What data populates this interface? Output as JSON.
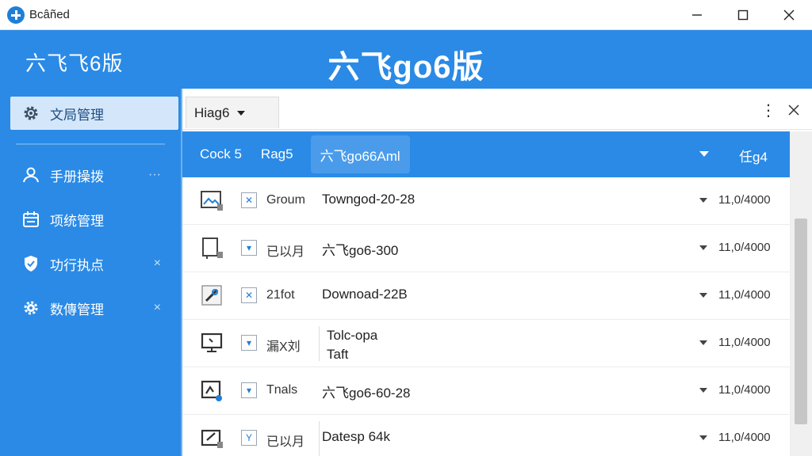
{
  "window": {
    "title": "Bcâñed",
    "controls": [
      "minimize-icon",
      "maximize-icon",
      "close-icon"
    ]
  },
  "header": {
    "brand": "六飞飞6版",
    "title": "六飞go6版"
  },
  "sidebar": {
    "items": [
      {
        "label": "文局管理",
        "icon": "gear-icon",
        "active": true,
        "tail": ""
      },
      {
        "label": "手册操拨",
        "icon": "user-icon",
        "active": false,
        "tail": "···"
      },
      {
        "label": "项统管理",
        "icon": "calendar-icon",
        "active": false,
        "tail": ""
      },
      {
        "label": "功行执点",
        "icon": "shield-icon",
        "active": false,
        "tail": "×"
      },
      {
        "label": "数傳管理",
        "icon": "gear-icon",
        "active": false,
        "tail": "×"
      }
    ]
  },
  "toolbar": {
    "dropdown_value": "Hiag6",
    "more_icon": "⋮"
  },
  "tabs": {
    "items": [
      "Cock 5",
      "Rag5",
      "六飞go66Aml"
    ],
    "active_index": 2,
    "right_label": "任g4"
  },
  "rows": [
    {
      "icon": "image-file-icon",
      "check": "✕",
      "label": "Groum",
      "name": "Towngod-20-28",
      "name2": "",
      "size": "11,0/4000"
    },
    {
      "icon": "device-file-icon",
      "check": "▾",
      "label": "已以月",
      "name": "六飞go6-300",
      "name2": "",
      "size": "11,0/4000"
    },
    {
      "icon": "link-file-icon",
      "check": "✕",
      "label": "21fot",
      "name": "Downoad-22B",
      "name2": "",
      "size": "11,0/4000"
    },
    {
      "icon": "monitor-icon",
      "check": "▾",
      "label": "漏X刘",
      "name": "Tolc-opa",
      "name2": "Taft",
      "size": "11,0/4000"
    },
    {
      "icon": "chart-file-icon",
      "check": "▾",
      "label": "Tnals",
      "name": "六飞go6-60-28",
      "name2": "",
      "size": "11,0/4000"
    },
    {
      "icon": "edit-file-icon",
      "check": "Y",
      "label": "已以月",
      "name": "Datesp 64k",
      "name2": "",
      "size": "11,0/4000"
    }
  ],
  "colors": {
    "primary": "#2a8ae6",
    "active_sidebar": "#d4e7fa",
    "active_tab": "#4a9ceb"
  }
}
